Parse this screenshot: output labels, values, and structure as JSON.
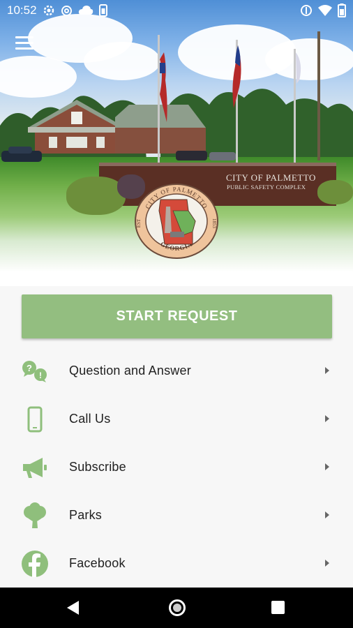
{
  "status_bar": {
    "time": "10:52",
    "left_icons": [
      "settings-gear-icon",
      "at-sign-icon",
      "cloud-icon",
      "phone-battery-icon"
    ],
    "right_icons": [
      "data-saver-icon",
      "wifi-icon",
      "battery-icon"
    ]
  },
  "hero": {
    "sign_line1": "CITY OF PALMETTO",
    "sign_line2": "PUBLIC SAFETY COMPLEX",
    "seal": {
      "top_text": "CITY OF PALMETTO",
      "bottom_text": "GEORGIA",
      "left_text": "EST",
      "right_text": "1853"
    }
  },
  "actions": {
    "start_request": "START REQUEST"
  },
  "menu": [
    {
      "label": "Question and Answer",
      "icon": "question-answer-icon"
    },
    {
      "label": "Call Us",
      "icon": "smartphone-icon"
    },
    {
      "label": "Subscribe",
      "icon": "megaphone-icon"
    },
    {
      "label": "Parks",
      "icon": "tree-icon"
    },
    {
      "label": "Facebook",
      "icon": "facebook-icon"
    }
  ],
  "colors": {
    "accent_green": "#93be80",
    "icon_green": "#8fbf7c",
    "text": "#212121"
  }
}
